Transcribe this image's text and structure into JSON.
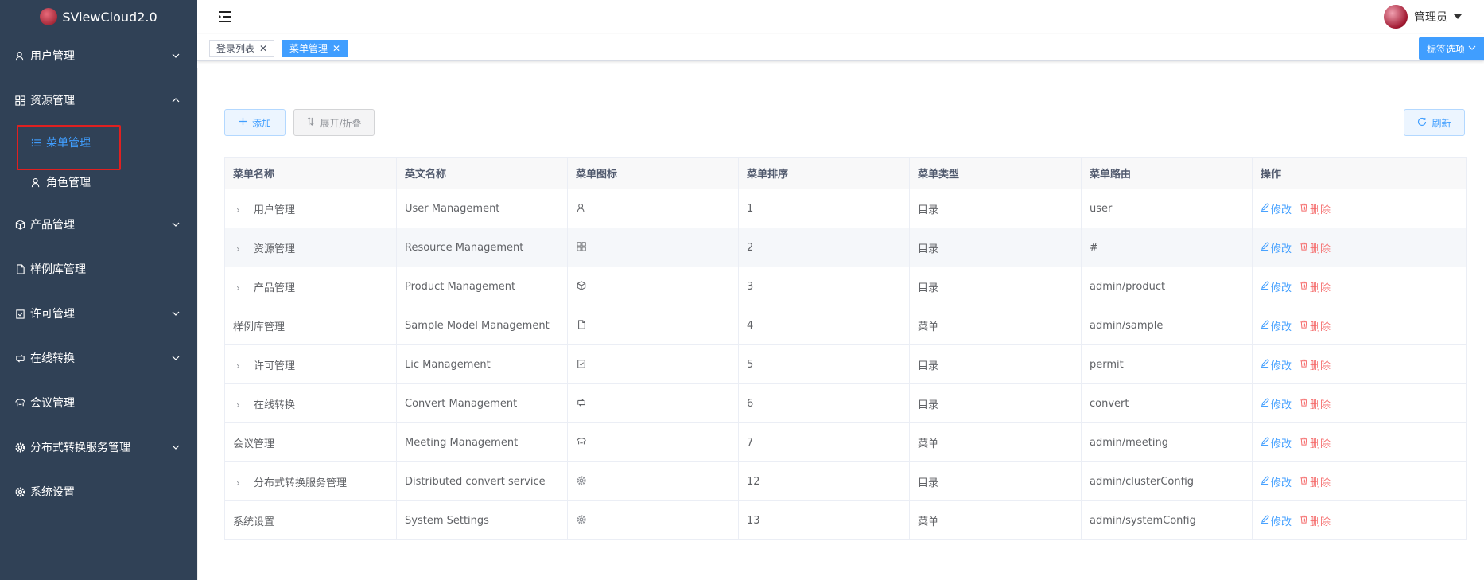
{
  "app": {
    "title": "SViewCloud2.0"
  },
  "sidebar": {
    "items": [
      {
        "label": "用户管理",
        "icon": "user-icon",
        "expandable": true,
        "expanded": false
      },
      {
        "label": "资源管理",
        "icon": "grid-icon",
        "expandable": true,
        "expanded": true,
        "children": [
          {
            "label": "菜单管理",
            "icon": "list-icon",
            "active": true
          },
          {
            "label": "角色管理",
            "icon": "user-icon",
            "active": false
          }
        ]
      },
      {
        "label": "产品管理",
        "icon": "box-icon",
        "expandable": true,
        "expanded": false
      },
      {
        "label": "样例库管理",
        "icon": "file-icon",
        "expandable": false
      },
      {
        "label": "许可管理",
        "icon": "clipboard-check-icon",
        "expandable": true,
        "expanded": false
      },
      {
        "label": "在线转换",
        "icon": "convert-icon",
        "expandable": true,
        "expanded": false
      },
      {
        "label": "会议管理",
        "icon": "meeting-icon",
        "expandable": false
      },
      {
        "label": "分布式转换服务管理",
        "icon": "gear-icon",
        "expandable": true,
        "expanded": false
      },
      {
        "label": "系统设置",
        "icon": "gear-icon",
        "expandable": false
      }
    ]
  },
  "header": {
    "user_name": "管理员"
  },
  "tags": {
    "items": [
      {
        "label": "登录列表",
        "active": false
      },
      {
        "label": "菜单管理",
        "active": true
      }
    ],
    "options_label": "标签选项"
  },
  "toolbar": {
    "add_label": "添加",
    "toggle_label": "展开/折叠",
    "refresh_label": "刷新"
  },
  "table": {
    "columns": [
      "菜单名称",
      "英文名称",
      "菜单图标",
      "菜单排序",
      "菜单类型",
      "菜单路由",
      "操作"
    ],
    "edit_label": "修改",
    "delete_label": "删除",
    "rows": [
      {
        "name": "用户管理",
        "en": "User Management",
        "icon": "user-icon",
        "order": "1",
        "type": "目录",
        "route": "user",
        "expandable": true
      },
      {
        "name": "资源管理",
        "en": "Resource Management",
        "icon": "grid-icon",
        "order": "2",
        "type": "目录",
        "route": "#",
        "expandable": true
      },
      {
        "name": "产品管理",
        "en": "Product Management",
        "icon": "box-icon",
        "order": "3",
        "type": "目录",
        "route": "admin/product",
        "expandable": true
      },
      {
        "name": "样例库管理",
        "en": "Sample Model Management",
        "icon": "file-icon",
        "order": "4",
        "type": "菜单",
        "route": "admin/sample",
        "expandable": false
      },
      {
        "name": "许可管理",
        "en": "Lic Management",
        "icon": "clipboard-check-icon",
        "order": "5",
        "type": "目录",
        "route": "permit",
        "expandable": true
      },
      {
        "name": "在线转换",
        "en": "Convert Management",
        "icon": "convert-icon",
        "order": "6",
        "type": "目录",
        "route": "convert",
        "expandable": true
      },
      {
        "name": "会议管理",
        "en": "Meeting Management",
        "icon": "meeting-icon",
        "order": "7",
        "type": "菜单",
        "route": "admin/meeting",
        "expandable": false
      },
      {
        "name": "分布式转换服务管理",
        "en": "Distributed convert service",
        "icon": "gear-icon",
        "order": "12",
        "type": "目录",
        "route": "admin/clusterConfig",
        "expandable": true
      },
      {
        "name": "系统设置",
        "en": "System Settings",
        "icon": "gear-icon",
        "order": "13",
        "type": "菜单",
        "route": "admin/systemConfig",
        "expandable": false
      }
    ]
  },
  "colors": {
    "sidebar_bg": "#304156",
    "primary": "#409eff",
    "danger": "#f56c6c",
    "highlight_border": "#e02020"
  }
}
